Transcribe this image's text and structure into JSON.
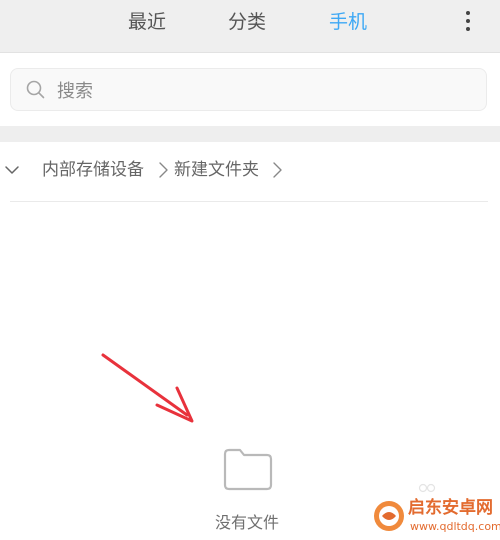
{
  "tabs": [
    {
      "id": "recent",
      "label": "最近",
      "active": false
    },
    {
      "id": "category",
      "label": "分类",
      "active": false
    },
    {
      "id": "phone",
      "label": "手机",
      "active": true
    }
  ],
  "search": {
    "placeholder": "搜索",
    "value": ""
  },
  "breadcrumb": {
    "items": [
      "内部存储设备",
      "新建文件夹"
    ]
  },
  "empty_state": {
    "icon": "folder-icon",
    "text": "没有文件"
  },
  "watermark": {
    "title": "启东安卓网",
    "url": "www.qdltdq.com"
  },
  "colors": {
    "accent": "#3da8f5",
    "tab_text": "#555555",
    "topbar_bg": "#efefef",
    "arrow": "#e8323c",
    "watermark": "#e36b2f"
  }
}
